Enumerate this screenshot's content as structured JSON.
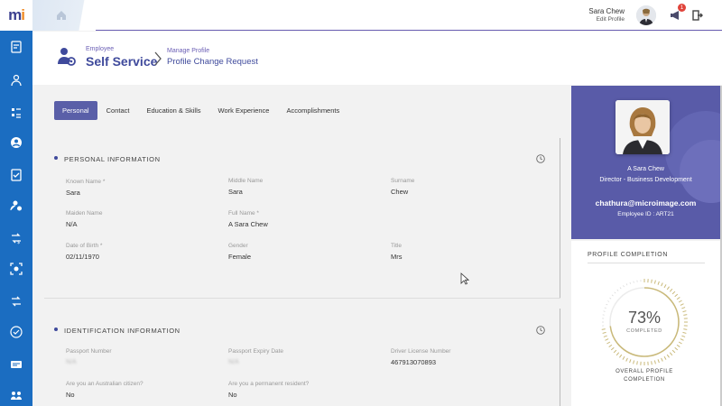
{
  "app": {
    "logo_text_m": "m",
    "logo_text_i": "i"
  },
  "topbar": {
    "user_name": "Sara Chew",
    "edit_profile": "Edit Profile",
    "notification_count": "1"
  },
  "header": {
    "section_small": "Employee",
    "section_big": "Self Service",
    "page_small": "Manage Profile",
    "page_big": "Profile Change Request"
  },
  "tabs": [
    "Personal",
    "Contact",
    "Education & Skills",
    "Work Experience",
    "Accomplishments"
  ],
  "personal": {
    "title": "PERSONAL INFORMATION",
    "fields": [
      {
        "label": "Known Name *",
        "value": "Sara"
      },
      {
        "label": "Middle Name",
        "value": "Sara"
      },
      {
        "label": "Surname",
        "value": "Chew"
      },
      {
        "label": "Maiden Name",
        "value": "N/A"
      },
      {
        "label": "Full Name *",
        "value": "A Sara Chew"
      },
      {
        "label": "Date of Birth *",
        "value": "02/11/1970"
      },
      {
        "label": "Gender",
        "value": "Female"
      },
      {
        "label": "Title",
        "value": "Mrs"
      }
    ]
  },
  "identification": {
    "title": "IDENTIFICATION INFORMATION",
    "fields": [
      {
        "label": "Passport Number",
        "value": "",
        "blurred": "N/A"
      },
      {
        "label": "Passport Expiry Date",
        "value": "",
        "blurred": "N/A"
      },
      {
        "label": "Driver License Number",
        "value": "467913070893"
      },
      {
        "label": "Are you an Australian citizen?",
        "value": "No"
      },
      {
        "label": "Are you a permanent resident?",
        "value": "No"
      }
    ]
  },
  "profile_card": {
    "name": "A Sara Chew",
    "role": "Director - Business Development",
    "email": "chathura@microimage.com",
    "employee_id": "Employee ID : ART21"
  },
  "completion": {
    "title": "PROFILE COMPLETION",
    "percent_label": "73%",
    "percent": 73,
    "completed_label": "COMPLETED",
    "caption": "OVERALL PROFILE COMPLETION"
  },
  "colors": {
    "sidebar": "#1b6dc1",
    "accent": "#5a5fa8",
    "card": "#595ba8",
    "gauge": "#c9b97a"
  }
}
